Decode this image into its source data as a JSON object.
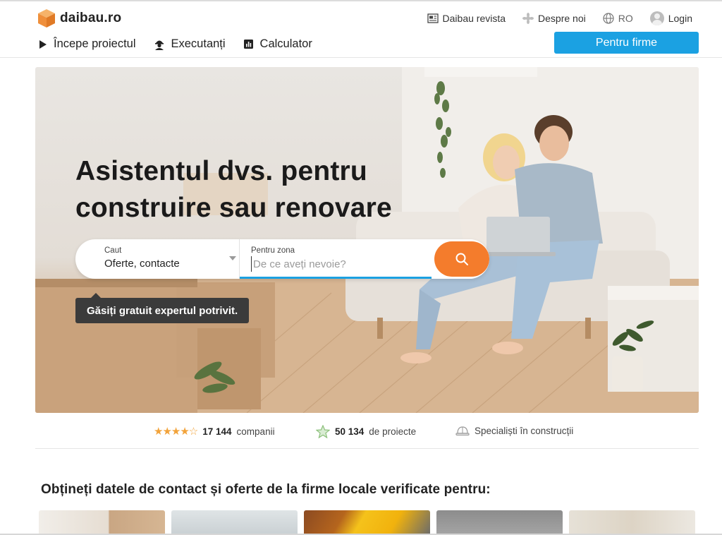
{
  "brand": {
    "name": "daibau.ro"
  },
  "util_nav": {
    "revista": "Daibau revista",
    "despre": "Despre noi",
    "language": "RO",
    "login": "Login"
  },
  "main_nav": {
    "start_project": "Începe proiectul",
    "executanti": "Executanți",
    "calculator": "Calculator",
    "firme_button": "Pentru firme"
  },
  "hero": {
    "title_line1": "Asistentul dvs. pentru",
    "title_line2": "construire sau renovare",
    "search": {
      "search_label": "Caut",
      "search_value": "Oferte, contacte",
      "zone_label": "Pentru zona",
      "zone_placeholder": "De ce aveți nevoie?"
    },
    "tooltip": "Găsiți gratuit expertul potrivit."
  },
  "stats": {
    "companies_count": "17 144",
    "companies_label": "companii",
    "projects_count": "50 134",
    "projects_label": "de proiecte",
    "specialists": "Specialiști în construcții"
  },
  "section": {
    "title": "Obțineți datele de contact și oferte de la firme locale verificate pentru:"
  },
  "colors": {
    "accent_blue": "#1ba1e2",
    "search_orange": "#f47c2c",
    "star_orange": "#f2a33a"
  },
  "icons": {
    "logo": "cube-logo-icon",
    "revista": "newspaper-icon",
    "despre": "sparkle-badge-icon",
    "language": "globe-icon",
    "login": "user-avatar-icon",
    "start_project": "play-triangle-icon",
    "executanti": "worker-helmet-icon",
    "calculator": "bar-chart-icon",
    "search": "magnifier-icon",
    "stars": "star-rating-icon",
    "projects": "star-outline-icon",
    "specialists": "hard-hat-icon"
  }
}
